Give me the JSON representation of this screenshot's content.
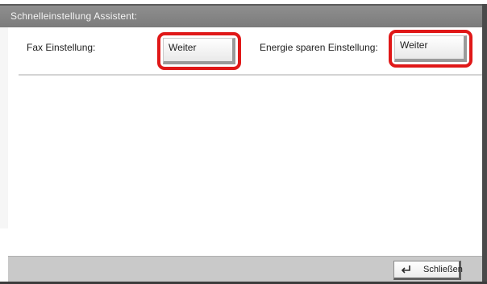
{
  "dialog": {
    "title": "Schnelleinstellung Assistent:"
  },
  "fax": {
    "label": "Fax Einstellung:",
    "button_label": "Weiter"
  },
  "energy": {
    "label": "Energie sparen Einstellung:",
    "button_label": "Weiter"
  },
  "footer": {
    "close_label": "Schließen",
    "close_icon": "return-arrow-icon"
  },
  "colors": {
    "highlight": "#e01818",
    "title_bar": "#858585",
    "footer_bg": "#c9c9c9"
  }
}
